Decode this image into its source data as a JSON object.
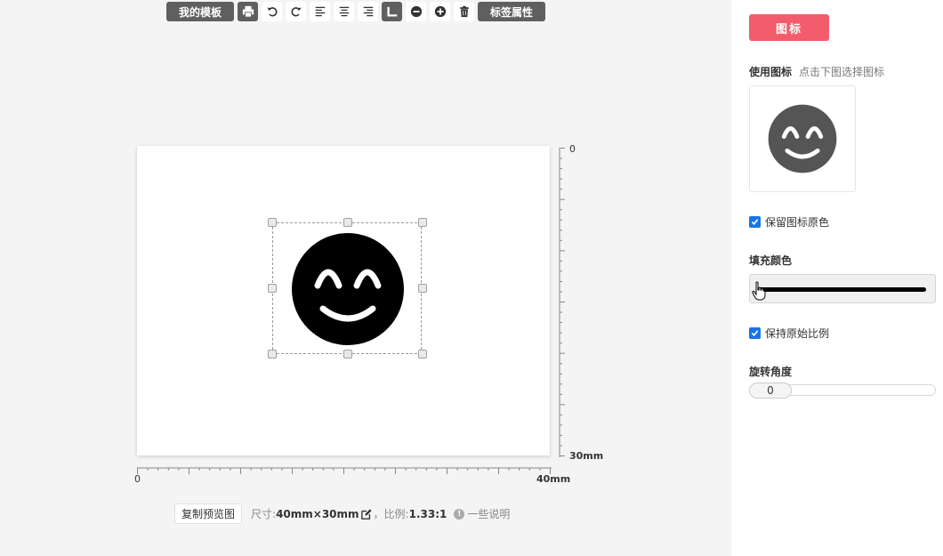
{
  "toolbar": {
    "my_templates": "我的模板",
    "label_props": "标签属性",
    "icons": [
      "print-icon",
      "undo-icon",
      "redo-icon",
      "align-left-icon",
      "align-center-icon",
      "align-right-icon",
      "ruler-toggle-icon",
      "zoom-out-icon",
      "zoom-in-icon",
      "trash-icon"
    ]
  },
  "ruler": {
    "v_start": "0",
    "v_end": "30mm",
    "h_start": "0",
    "h_end": "40mm"
  },
  "status": {
    "copy_button": "复制预览图",
    "size_label": "尺寸:",
    "size_value": "40mm×30mm",
    "separator": "，",
    "ratio_label": "比例:",
    "ratio_value": "1.33:1",
    "info_glyph": "!",
    "notes": "一些说明"
  },
  "sidebar": {
    "title": "图标",
    "use_icon_label": "使用图标",
    "use_icon_hint": "点击下图选择图标",
    "keep_original_color": "保留图标原色",
    "fill_color_label": "填充颜色",
    "fill_color": "#000000",
    "keep_ratio": "保持原始比例",
    "rotation_label": "旋转角度",
    "rotation_value": "0"
  },
  "colors": {
    "accent": "#f35c6a",
    "checkbox": "#1a73e8",
    "toolbar_dark": "#5f5f5f",
    "icon_preview": "#555555",
    "icon_canvas": "#000000"
  }
}
